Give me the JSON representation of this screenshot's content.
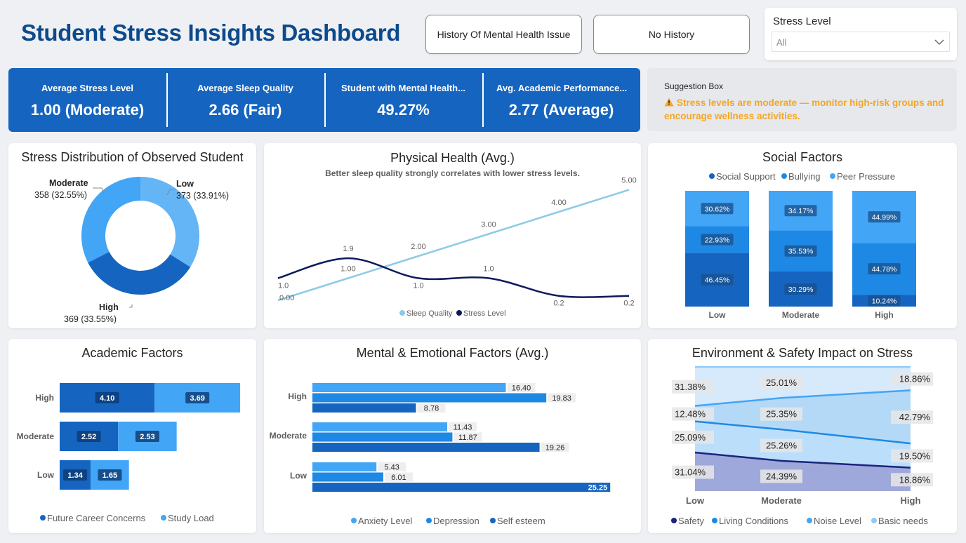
{
  "header": {
    "title": "Student Stress Insights Dashboard",
    "btn_history": "History Of Mental Health Issue",
    "btn_no_history": "No History",
    "slicer_label": "Stress Level",
    "slicer_value": "All"
  },
  "kpis": [
    {
      "label": "Average Stress Level",
      "value": "1.00 (Moderate)"
    },
    {
      "label": "Average Sleep Quality",
      "value": "2.66 (Fair)"
    },
    {
      "label": "Student with Mental Health...",
      "value": "49.27%"
    },
    {
      "label": "Avg. Academic Performance...",
      "value": "2.77 (Average)"
    }
  ],
  "suggestion": {
    "label": "Suggestion Box",
    "icon": "warning-icon",
    "text": "Stress levels are moderate — monitor high-risk groups and encourage wellness activities.",
    "color": "#f5a623"
  },
  "colors": {
    "dark_blue": "#1565c0",
    "mid_blue": "#1e88e5",
    "light_blue": "#42a5f5",
    "navy": "#0d1a5c",
    "sky": "#8ecae6"
  },
  "chart_data": [
    {
      "type": "pie",
      "title": "Stress Distribution of Observed Student",
      "slices": [
        {
          "name": "Low",
          "value": 373,
          "label": "Low",
          "sub": "373 (33.91%)",
          "color": "#64b5f6"
        },
        {
          "name": "High",
          "value": 369,
          "label": "High",
          "sub": "369 (33.55%)",
          "color": "#1565c0"
        },
        {
          "name": "Moderate",
          "value": 358,
          "label": "Moderate",
          "sub": "358 (32.55%)",
          "color": "#42a5f5"
        }
      ]
    },
    {
      "type": "line",
      "title": "Physical Health (Avg.)",
      "subtitle": "Better sleep quality strongly correlates with lower stress levels.",
      "x": [
        0,
        1,
        2,
        3,
        4,
        5
      ],
      "series": [
        {
          "name": "Sleep Quality",
          "values": [
            0.0,
            1.0,
            2.0,
            3.0,
            4.0,
            5.0
          ],
          "labels": [
            "0.00",
            "1.00",
            "2.00",
            "3.00",
            "4.00",
            "5.00"
          ],
          "color": "#8ecae6"
        },
        {
          "name": "Stress Level",
          "values": [
            1.0,
            1.9,
            1.0,
            1.0,
            0.2,
            0.2
          ],
          "labels": [
            "1.0",
            "1.9",
            "1.0",
            "1.0",
            "0.2",
            "0.2"
          ],
          "color": "#0d1a5c"
        }
      ]
    },
    {
      "type": "bar",
      "stacked": "100%",
      "title": "Social Factors",
      "categories": [
        "Low",
        "Moderate",
        "High"
      ],
      "series": [
        {
          "name": "Social Support",
          "values": [
            46.45,
            30.29,
            10.24
          ],
          "labels": [
            "46.45%",
            "30.29%",
            "10.24%"
          ],
          "color": "#1565c0"
        },
        {
          "name": "Bullying",
          "values": [
            22.93,
            35.53,
            44.78
          ],
          "labels": [
            "22.93%",
            "35.53%",
            "44.78%"
          ],
          "color": "#1e88e5"
        },
        {
          "name": "Peer Pressure",
          "values": [
            30.62,
            34.17,
            44.99
          ],
          "labels": [
            "30.62%",
            "34.17%",
            "44.99%"
          ],
          "color": "#42a5f5"
        }
      ]
    },
    {
      "type": "bar",
      "orientation": "horizontal",
      "stacked": true,
      "title": "Academic Factors",
      "categories": [
        "High",
        "Moderate",
        "Low"
      ],
      "series": [
        {
          "name": "Future Career Concerns",
          "values": [
            4.1,
            2.52,
            1.34
          ],
          "labels": [
            "4.10",
            "2.52",
            "1.34"
          ],
          "color": "#1565c0"
        },
        {
          "name": "Study Load",
          "values": [
            3.69,
            2.53,
            1.65
          ],
          "labels": [
            "3.69",
            "2.53",
            "1.65"
          ],
          "color": "#42a5f5"
        }
      ]
    },
    {
      "type": "bar",
      "orientation": "horizontal",
      "title": "Mental & Emotional Factors (Avg.)",
      "categories": [
        "High",
        "Moderate",
        "Low"
      ],
      "series": [
        {
          "name": "Anxiety Level",
          "values": [
            16.4,
            11.43,
            5.43
          ],
          "labels": [
            "16.40",
            "11.43",
            "5.43"
          ],
          "color": "#42a5f5"
        },
        {
          "name": "Depression",
          "values": [
            19.83,
            11.87,
            6.01
          ],
          "labels": [
            "19.83",
            "11.87",
            "6.01"
          ],
          "color": "#1e88e5"
        },
        {
          "name": "Self esteem",
          "values": [
            8.78,
            19.26,
            25.25
          ],
          "labels": [
            "8.78",
            "19.26",
            "25.25"
          ],
          "color": "#1565c0"
        }
      ]
    },
    {
      "type": "area",
      "stacked": "100%",
      "title": "Environment & Safety Impact on Stress",
      "categories": [
        "Low",
        "Moderate",
        "High"
      ],
      "series": [
        {
          "name": "Safety",
          "values": [
            31.04,
            24.39,
            18.86
          ],
          "labels": [
            "31.04%",
            "24.39%",
            "18.86%"
          ],
          "color": "#1a237e"
        },
        {
          "name": "Living Conditions",
          "values": [
            25.09,
            25.26,
            19.5
          ],
          "labels": [
            "25.09%",
            "25.26%",
            "19.50%"
          ],
          "color": "#1e88e5"
        },
        {
          "name": "Noise Level",
          "values": [
            12.48,
            25.35,
            42.79
          ],
          "labels": [
            "12.48%",
            "25.35%",
            "42.79%"
          ],
          "color": "#42a5f5"
        },
        {
          "name": "Basic needs",
          "values": [
            31.38,
            25.01,
            18.86
          ],
          "labels": [
            "31.38%",
            "25.01%",
            "18.86%"
          ],
          "color": "#90caf9"
        }
      ]
    }
  ]
}
